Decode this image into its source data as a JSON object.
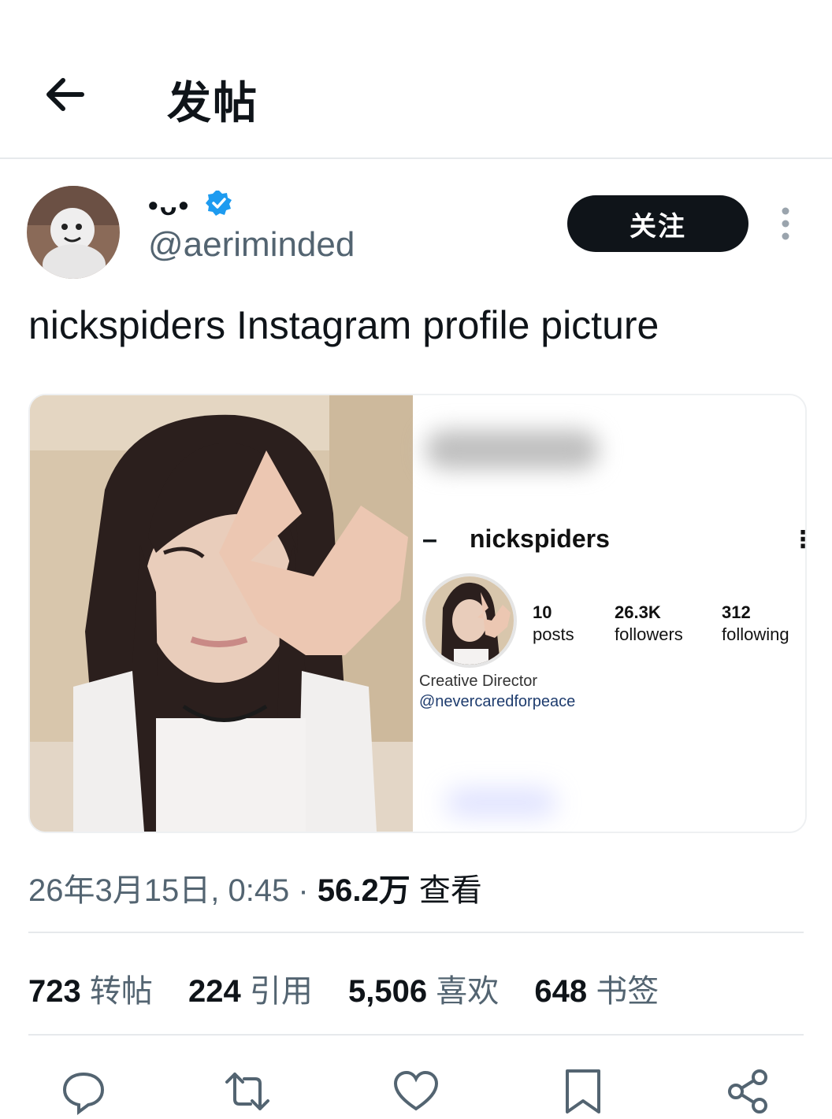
{
  "header": {
    "title": "发帖"
  },
  "author": {
    "display_name": "•ᴗ•",
    "handle": "@aeriminded",
    "verified": true,
    "follow_label": "关注"
  },
  "tweet": {
    "text": "nickspiders Instagram profile picture"
  },
  "media": {
    "instagram": {
      "username": "nickspiders",
      "posts_count": "10",
      "posts_label": "posts",
      "followers_count": "26.3K",
      "followers_label": "followers",
      "following_count": "312",
      "following_label": "following",
      "bio_line1": "Creative Director",
      "bio_line2": "@nevercaredforpeace"
    }
  },
  "meta": {
    "datetime": "26年3月15日, 0:45 · ",
    "views_count": "56.2万",
    "views_label": "查看"
  },
  "stats": [
    {
      "count": "723",
      "label": "转帖"
    },
    {
      "count": "224",
      "label": "引用"
    },
    {
      "count": "5,506",
      "label": "喜欢"
    },
    {
      "count": "648",
      "label": "书签"
    }
  ],
  "icons": {
    "back": "arrow-left-icon",
    "verified": "verified-badge-icon",
    "more": "more-vertical-icon",
    "reply": "reply-icon",
    "repost": "repost-icon",
    "like": "heart-icon",
    "bookmark": "bookmark-icon",
    "share": "share-icon"
  },
  "colors": {
    "accent": "#1d9bf0",
    "text": "#0f1419",
    "secondary": "#536471",
    "button": "#0f1419"
  }
}
